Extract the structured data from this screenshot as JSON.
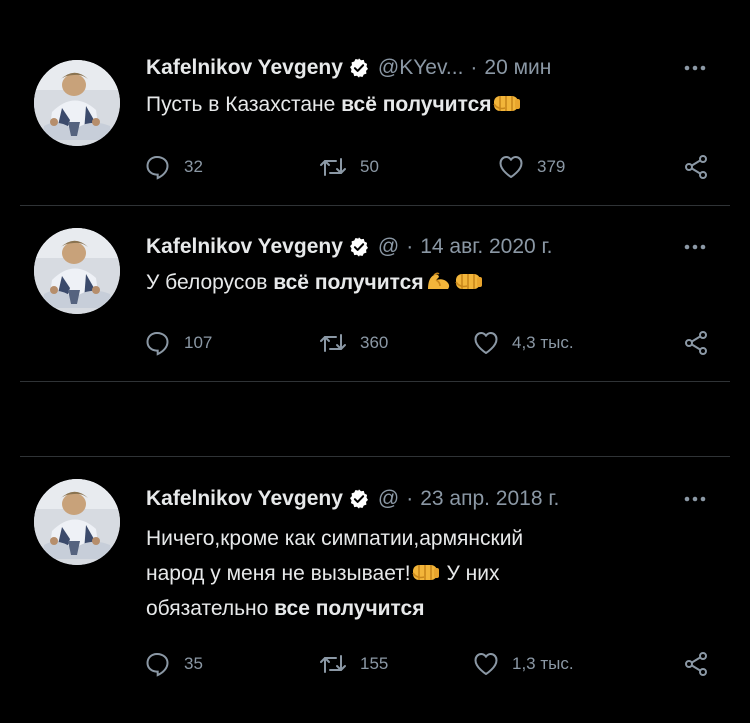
{
  "colors": {
    "background": "#000000",
    "text": "#e7e9ea",
    "muted": "#8b98a5",
    "verified_badge": "#ffffff",
    "divider": "#2f3336"
  },
  "tweets": [
    {
      "name": "Kafelnikov Yevgeny",
      "handle": "@KYev...",
      "dot": "·",
      "time": "20 мин",
      "text_plain": "Пусть в Казахстане ",
      "text_bold": "всё получится",
      "emoji": [
        "fist-emoji"
      ],
      "replies": "32",
      "retweets": "50",
      "likes": "379",
      "icons": [
        "reply-icon",
        "retweet-icon",
        "like-icon",
        "share-icon",
        "more-icon",
        "verified-badge-icon"
      ]
    },
    {
      "name": "Kafelnikov Yevgeny",
      "handle": "@",
      "dot": "·",
      "time": "14 авг. 2020 г.",
      "text_plain": "У белорусов ",
      "text_bold": "всё получится",
      "emoji": [
        "flexed-biceps-emoji",
        "fist-emoji"
      ],
      "replies": "107",
      "retweets": "360",
      "likes": "4,3 тыс.",
      "icons": [
        "reply-icon",
        "retweet-icon",
        "like-icon",
        "share-icon",
        "more-icon",
        "verified-badge-icon"
      ]
    },
    {
      "name": "Kafelnikov Yevgeny",
      "handle": "@",
      "dot": "·",
      "time": "23 апр. 2018 г.",
      "text_line1": "Ничего,кроме как симпатии,армянский",
      "text_line2_before": "народ у меня не вызывает!",
      "text_line2_after": " У них",
      "text_line3_plain": "обязательно ",
      "text_bold": "все получится",
      "emoji": [
        "fist-emoji"
      ],
      "replies": "35",
      "retweets": "155",
      "likes": "1,3 тыс.",
      "icons": [
        "reply-icon",
        "retweet-icon",
        "like-icon",
        "share-icon",
        "more-icon",
        "verified-badge-icon"
      ]
    }
  ]
}
